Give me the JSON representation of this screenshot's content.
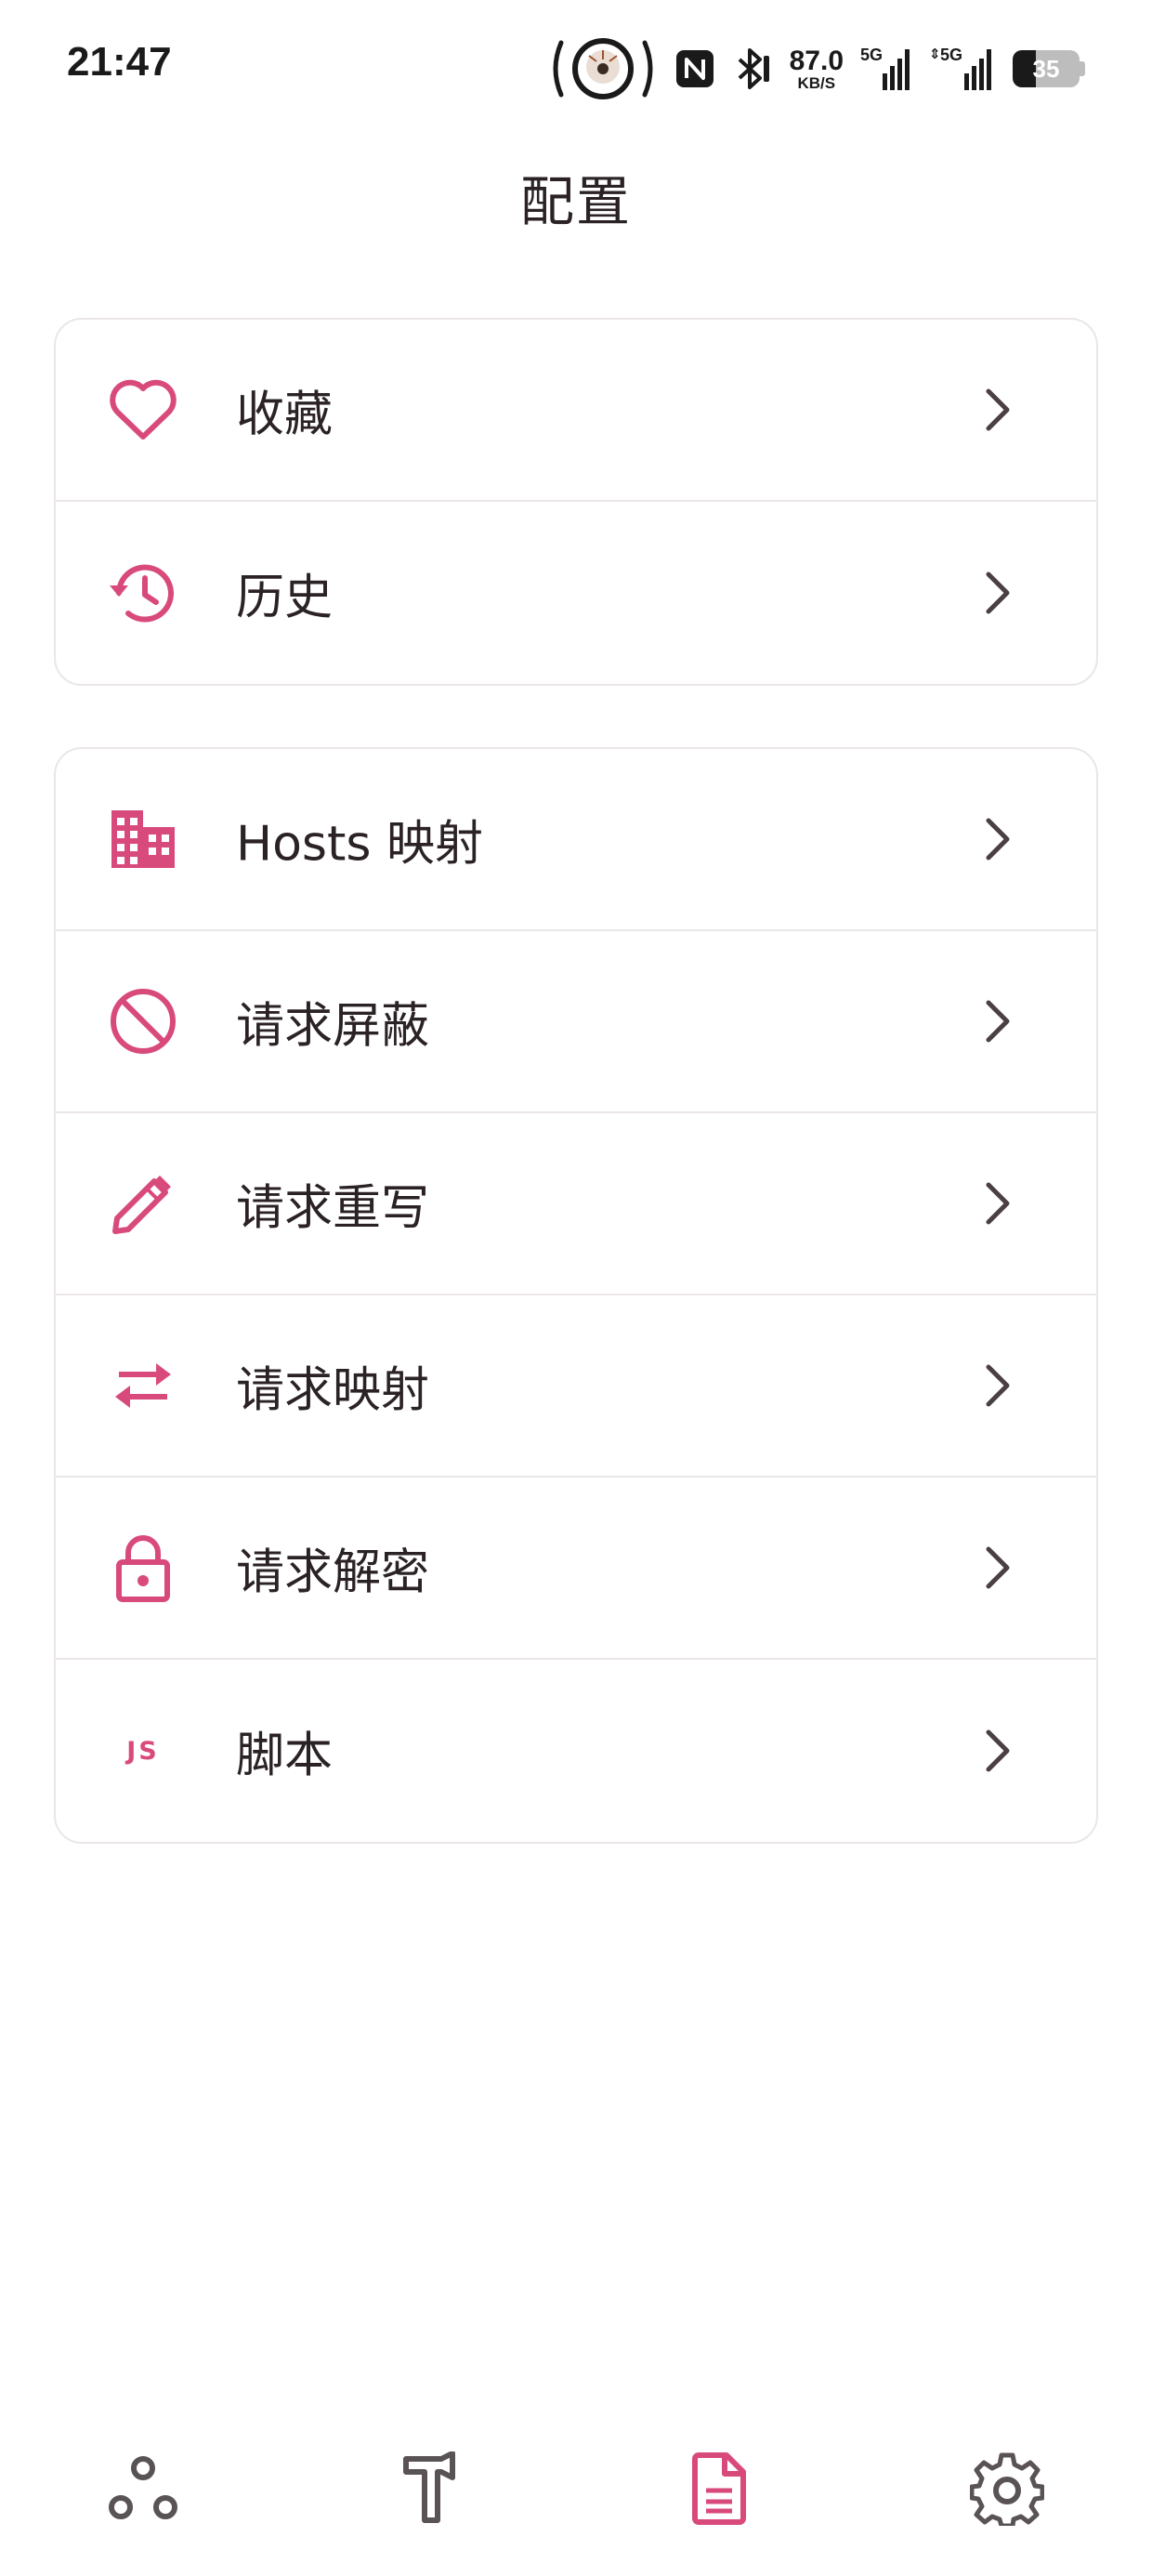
{
  "status_bar": {
    "time": "21:47",
    "net_speed_value": "87.0",
    "net_speed_unit": "KB/S",
    "signal_1_label": "5G",
    "signal_2_label": "5G",
    "battery_level": "35",
    "battery_fraction": 0.35
  },
  "page": {
    "title": "配置"
  },
  "group1": [
    {
      "label": "收藏",
      "icon": "heart-icon"
    },
    {
      "label": "历史",
      "icon": "history-icon"
    }
  ],
  "group2": [
    {
      "label": "Hosts 映射",
      "icon": "building-icon"
    },
    {
      "label": "请求屏蔽",
      "icon": "block-icon"
    },
    {
      "label": "请求重写",
      "icon": "pencil-icon"
    },
    {
      "label": "请求映射",
      "icon": "swap-arrows-icon"
    },
    {
      "label": "请求解密",
      "icon": "lock-icon",
      "note": ""
    },
    {
      "label": "脚本",
      "icon": "js-icon",
      "icon_text": "JS"
    }
  ],
  "bottom_nav": [
    {
      "name": "network-nodes-icon",
      "active": false
    },
    {
      "name": "toolbox-hammer-icon",
      "active": false
    },
    {
      "name": "config-document-icon",
      "active": true
    },
    {
      "name": "settings-gear-icon",
      "active": false
    }
  ],
  "colors": {
    "accent": "#d94a7c",
    "text": "#2b2226",
    "divider": "#ebe6e8",
    "nav_inactive": "#5a5356"
  }
}
